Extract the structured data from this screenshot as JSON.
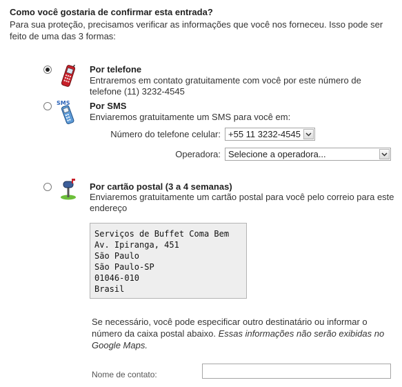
{
  "heading": "Como você gostaria de confirmar esta entrada?",
  "intro": "Para sua proteção, precisamos verificar as informações que você nos forneceu. Isso pode ser feito de uma das 3 formas:",
  "options": [
    {
      "title": "Por telefone",
      "desc": "Entraremos em contato gratuitamente com você por este número de telefone  (11) 3232-4545",
      "checked": true,
      "icon": "mobile-phone-icon"
    },
    {
      "title": "Por SMS",
      "desc": "Enviaremos gratuitamente um SMS para você em:",
      "checked": false,
      "icon": "sms-phone-icon"
    },
    {
      "title": "Por cartão postal (3 a 4 semanas)",
      "desc": "Enviaremos gratuitamente um cartão postal para você pelo correio para este endereço",
      "checked": false,
      "icon": "mailbox-icon"
    }
  ],
  "sms": {
    "phone_label": "Número do telefone celular:",
    "phone_value": "+55 11 3232-4545",
    "carrier_label": "Operadora:",
    "carrier_value": "Selecione a operadora..."
  },
  "address_lines": [
    "Serviços de Buffet Coma Bem",
    "Av. Ipiranga, 451",
    "São Paulo",
    "São Paulo-SP",
    "01046-010",
    "Brasil"
  ],
  "note_text": "Se necessário, você pode especificar outro destinatário ou informar o número da caixa postal abaixo. ",
  "note_italic": "Essas informações não serão exibidas no Google Maps.",
  "contact_label": "Nome de contato:",
  "contact_value": ""
}
